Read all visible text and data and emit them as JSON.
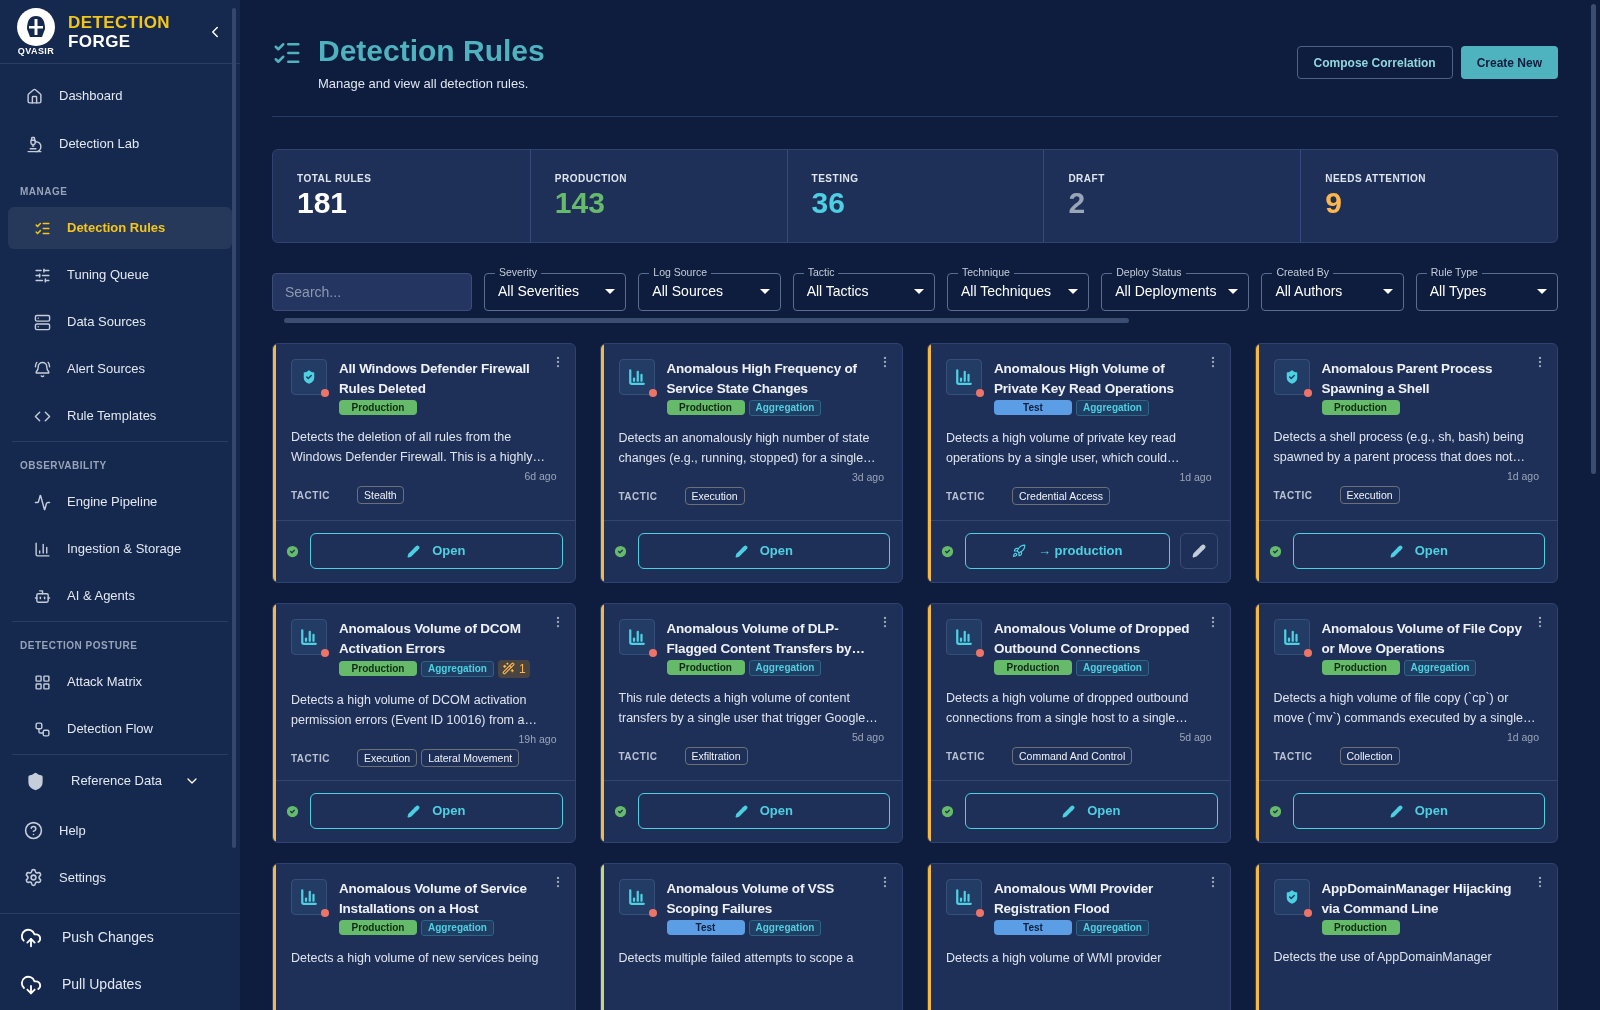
{
  "sidebar": {
    "brand": {
      "line1": "DETECTION",
      "line2": "FORGE",
      "logo_text": "QVASIR"
    },
    "top_items": [
      {
        "label": "Dashboard",
        "selected": false
      },
      {
        "label": "Detection Lab",
        "selected": false
      }
    ],
    "sections": [
      {
        "heading": "MANAGE",
        "items": [
          {
            "label": "Detection Rules",
            "selected": true
          },
          {
            "label": "Tuning Queue",
            "selected": false
          },
          {
            "label": "Data Sources",
            "selected": false
          },
          {
            "label": "Alert Sources",
            "selected": false
          },
          {
            "label": "Rule Templates",
            "selected": false
          }
        ]
      },
      {
        "heading": "OBSERVABILITY",
        "items": [
          {
            "label": "Engine Pipeline",
            "selected": false
          },
          {
            "label": "Ingestion & Storage",
            "selected": false
          },
          {
            "label": "AI & Agents",
            "selected": false
          }
        ]
      },
      {
        "heading": "DETECTION POSTURE",
        "items": [
          {
            "label": "Attack Matrix",
            "selected": false
          },
          {
            "label": "Detection Flow",
            "selected": false
          }
        ]
      }
    ],
    "reference": {
      "label": "Reference Data",
      "expanded": false
    },
    "bottom_items": [
      {
        "label": "Help"
      },
      {
        "label": "Settings"
      }
    ],
    "sync_items": [
      {
        "label": "Push Changes"
      },
      {
        "label": "Pull Updates"
      }
    ]
  },
  "header": {
    "title": "Detection Rules",
    "subtitle": "Manage and view all detection rules.",
    "buttons": [
      {
        "label": "Compose Correlation",
        "kind": "outline"
      },
      {
        "label": "Create New",
        "kind": "filled"
      }
    ]
  },
  "stats": [
    {
      "label": "TOTAL RULES",
      "value": "181",
      "color": "#ffffff"
    },
    {
      "label": "PRODUCTION",
      "value": "143",
      "color": "#66bb6a"
    },
    {
      "label": "TESTING",
      "value": "36",
      "color": "#4dd0e1"
    },
    {
      "label": "DRAFT",
      "value": "2",
      "color": "#9aa5b8"
    },
    {
      "label": "NEEDS ATTENTION",
      "value": "9",
      "color": "#ffb74d"
    }
  ],
  "filters": {
    "search": {
      "placeholder": "Search..."
    },
    "selects": [
      {
        "label": "Severity",
        "value": "All Severities"
      },
      {
        "label": "Log Source",
        "value": "All Sources"
      },
      {
        "label": "Tactic",
        "value": "All Tactics"
      },
      {
        "label": "Technique",
        "value": "All Techniques"
      },
      {
        "label": "Deploy Status",
        "value": "All Deployments"
      },
      {
        "label": "Created By",
        "value": "All Authors"
      },
      {
        "label": "Rule Type",
        "value": "All Types"
      }
    ]
  },
  "cards": [
    {
      "title": "All Windows Defender Firewall Rules Deleted",
      "kind": "shield",
      "color": "#f5b942",
      "status": {
        "label": "Production",
        "kind": "production"
      },
      "description": "Detects the deletion of all rules from the Windows Defender Firewall. This is a highly…",
      "time": "6d ago",
      "tactic_label": "TACTIC",
      "tactics": [
        "Stealth"
      ],
      "action": {
        "kind": "open",
        "label": "Open"
      }
    },
    {
      "title": "Anomalous High Frequency of Service State Changes",
      "kind": "chart",
      "color": "#f5b942",
      "status": {
        "label": "Production",
        "kind": "production"
      },
      "type": "Aggregation",
      "description": "Detects an anomalously high number of state changes (e.g., running, stopped) for a single…",
      "time": "3d ago",
      "tactic_label": "TACTIC",
      "tactics": [
        "Execution"
      ],
      "action": {
        "kind": "open",
        "label": "Open"
      }
    },
    {
      "title": "Anomalous High Volume of Private Key Read Operations",
      "kind": "chart",
      "color": "#f5b942",
      "status": {
        "label": "Test",
        "kind": "test"
      },
      "type": "Aggregation",
      "description": "Detects a high volume of private key read operations by a single user, which could…",
      "time": "1d ago",
      "tactic_label": "TACTIC",
      "tactics": [
        "Credential Access"
      ],
      "action": {
        "kind": "promote",
        "label": "→ production"
      }
    },
    {
      "title": "Anomalous Parent Process Spawning a Shell",
      "kind": "shield",
      "color": "#f5b942",
      "status": {
        "label": "Production",
        "kind": "production"
      },
      "description": "Detects a shell process (e.g., sh, bash) being spawned by a parent process that does not…",
      "time": "1d ago",
      "tactic_label": "TACTIC",
      "tactics": [
        "Execution"
      ],
      "action": {
        "kind": "open",
        "label": "Open"
      }
    },
    {
      "title": "Anomalous Volume of DCOM Activation Errors",
      "kind": "chart",
      "color": "#f5b942",
      "status": {
        "label": "Production",
        "kind": "production"
      },
      "type": "Aggregation",
      "tuning": "1",
      "description": "Detects a high volume of DCOM activation permission errors (Event ID 10016) from a…",
      "time": "19h ago",
      "tactic_label": "TACTIC",
      "tactics": [
        "Execution",
        "Lateral Movement"
      ],
      "action": {
        "kind": "open",
        "label": "Open"
      }
    },
    {
      "title": "Anomalous Volume of DLP-Flagged Content Transfers by…",
      "kind": "chart",
      "color": "#f5b942",
      "status": {
        "label": "Production",
        "kind": "production"
      },
      "type": "Aggregation",
      "description": "This rule detects a high volume of content transfers by a single user that trigger Google…",
      "time": "5d ago",
      "tactic_label": "TACTIC",
      "tactics": [
        "Exfiltration"
      ],
      "action": {
        "kind": "open",
        "label": "Open"
      }
    },
    {
      "title": "Anomalous Volume of Dropped Outbound Connections",
      "kind": "chart",
      "color": "#f5b942",
      "status": {
        "label": "Production",
        "kind": "production"
      },
      "type": "Aggregation",
      "description": "Detects a high volume of dropped outbound connections from a single host to a single…",
      "time": "5d ago",
      "tactic_label": "TACTIC",
      "tactics": [
        "Command And Control"
      ],
      "action": {
        "kind": "open",
        "label": "Open"
      }
    },
    {
      "title": "Anomalous Volume of File Copy or Move Operations",
      "kind": "chart",
      "color": "#f5b942",
      "status": {
        "label": "Production",
        "kind": "production"
      },
      "type": "Aggregation",
      "description": "Detects a high volume of file copy (`cp`) or move (`mv`) commands executed by a single…",
      "time": "1d ago",
      "tactic_label": "TACTIC",
      "tactics": [
        "Collection"
      ],
      "action": {
        "kind": "open",
        "label": "Open"
      }
    },
    {
      "title": "Anomalous Volume of Service Installations on a Host",
      "kind": "chart",
      "color": "#f5b942",
      "status": {
        "label": "Production",
        "kind": "production"
      },
      "type": "Aggregation",
      "description": "Detects a high volume of new services being"
    },
    {
      "title": "Anomalous Volume of VSS Scoping Failures",
      "kind": "chart",
      "color": "#c9d86a",
      "status": {
        "label": "Test",
        "kind": "test"
      },
      "type": "Aggregation",
      "description": "Detects multiple failed attempts to scope a"
    },
    {
      "title": "Anomalous WMI Provider Registration Flood",
      "kind": "chart",
      "color": "#f5b942",
      "status": {
        "label": "Test",
        "kind": "test"
      },
      "type": "Aggregation",
      "description": "Detects a high volume of WMI provider"
    },
    {
      "title": "AppDomainManager Hijacking via Command Line",
      "kind": "shield",
      "color": "#f5b942",
      "status": {
        "label": "Production",
        "kind": "production"
      },
      "description": "Detects the use of AppDomainManager"
    }
  ]
}
